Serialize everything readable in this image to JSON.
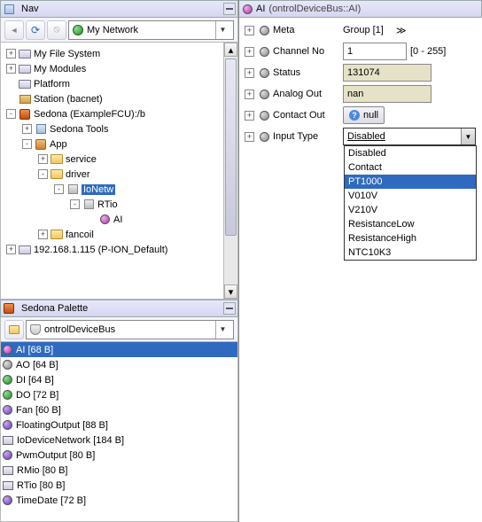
{
  "nav": {
    "title": "Nav",
    "network_combo": "My Network",
    "tree": [
      {
        "indent": 0,
        "exp": "+",
        "icon": "drive",
        "label": "My File System"
      },
      {
        "indent": 0,
        "exp": "+",
        "icon": "drive",
        "label": "My Modules"
      },
      {
        "indent": 0,
        "exp": " ",
        "icon": "drive",
        "label": "Platform"
      },
      {
        "indent": 0,
        "exp": " ",
        "icon": "stn",
        "label": "Station (bacnet)"
      },
      {
        "indent": 0,
        "exp": "-",
        "icon": "sed",
        "label": "Sedona (ExampleFCU):/b"
      },
      {
        "indent": 1,
        "exp": "+",
        "icon": "cube",
        "label": "Sedona Tools"
      },
      {
        "indent": 1,
        "exp": "-",
        "icon": "app",
        "label": "App"
      },
      {
        "indent": 2,
        "exp": "+",
        "icon": "fold",
        "label": "service"
      },
      {
        "indent": 2,
        "exp": "-",
        "icon": "fold",
        "label": "driver"
      },
      {
        "indent": 3,
        "exp": "-",
        "icon": "svc",
        "label": "IoNetw",
        "selected": true
      },
      {
        "indent": 4,
        "exp": "-",
        "icon": "svc",
        "label": "RTio"
      },
      {
        "indent": 5,
        "exp": " ",
        "icon": "dotm",
        "label": "AI"
      },
      {
        "indent": 2,
        "exp": "+",
        "icon": "fold",
        "label": "fancoil"
      },
      {
        "indent": 0,
        "exp": "+",
        "icon": "drive",
        "label": "192.168.1.115 (P-ION_Default)"
      }
    ]
  },
  "palette": {
    "title": "Sedona Palette",
    "combo": "ontrolDeviceBus",
    "items": [
      {
        "icon": "mag",
        "label": "AI [68 B]",
        "selected": true
      },
      {
        "icon": "gray",
        "label": "AO [64 B]"
      },
      {
        "icon": "green",
        "label": "DI [64 B]"
      },
      {
        "icon": "green",
        "label": "DO [72 B]"
      },
      {
        "icon": "purple",
        "label": "Fan [60 B]"
      },
      {
        "icon": "purple",
        "label": "FloatingOutput [88 B]"
      },
      {
        "icon": "sq",
        "label": "IoDeviceNetwork [184 B]"
      },
      {
        "icon": "purple",
        "label": "PwmOutput [80 B]"
      },
      {
        "icon": "sq",
        "label": "RMio [80 B]"
      },
      {
        "icon": "sq",
        "label": "RTio [80 B]"
      },
      {
        "icon": "purple",
        "label": "TimeDate [72 B]"
      }
    ]
  },
  "propsheet": {
    "header_name": "AI",
    "header_type": "(ontrolDeviceBus::AI)",
    "rows": {
      "meta": {
        "label": "Meta",
        "value": "Group [1]"
      },
      "channel": {
        "label": "Channel No",
        "value": "1",
        "range": "[0 - 255]"
      },
      "status": {
        "label": "Status",
        "value": "131074"
      },
      "analogout": {
        "label": "Analog Out",
        "value": "nan"
      },
      "contactout": {
        "label": "Contact Out",
        "value": "null"
      },
      "inputtype": {
        "label": "Input Type",
        "value": "Disabled"
      }
    },
    "dropdown_options": [
      "Disabled",
      "Contact",
      "PT1000",
      "V010V",
      "V210V",
      "ResistanceLow",
      "ResistanceHigh",
      "NTC10K3"
    ],
    "dropdown_highlight": "PT1000"
  }
}
